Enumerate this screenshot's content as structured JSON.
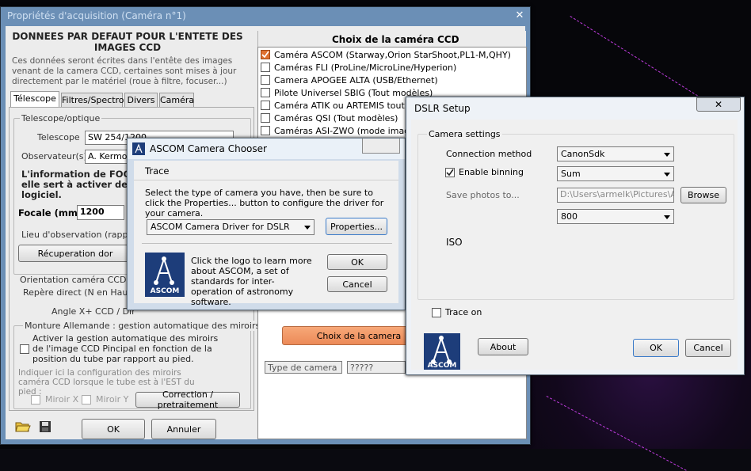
{
  "main": {
    "title": "Propriétés d'acquisition (Caméra n°1)",
    "heading": "DONNEES PAR DEFAUT POUR L'ENTETE DES IMAGES CCD",
    "intro": "Ces données seront écrites dans l'entête des images  venant de la camera CCD, certaines sont mises à jour directement par le matériel (roue à filtre, focuser...)",
    "tabs": [
      {
        "label": "Télescope"
      },
      {
        "label": "Filtres/Spectro"
      },
      {
        "label": "Divers"
      },
      {
        "label": "Caméra"
      }
    ],
    "telescope": {
      "group_label": "Telescope/optique",
      "telescope_label": "Telescope",
      "telescope_value": "SW 254/1200",
      "observer_label": "Observateur(s)",
      "observer_value": "A. Kermor",
      "focal_info_line1": "L'information de FOCAL",
      "focal_info_line2": "elle sert à activer des f",
      "focal_info_line3": "logiciel.",
      "focal_label": "Focale (mm)",
      "focal_value": "1200",
      "lieu_label": "Lieu d'observation (rappel)",
      "recup_button": "Récuperation dor"
    },
    "orientation": {
      "group_label": "Orientation caméra CCD",
      "repere": "Repère direct (N en Haut, E",
      "angle": "Angle X+ CCD / Dir"
    },
    "monture": {
      "group_label": "Monture Allemande : gestion automatique des miroirs",
      "checkbox_text": "Activer la gestion automatique des miroirs de l'image CCD Pincipal en fonction de la position du tube par rapport au pied.",
      "config_text": "Indiquer ici la configuration des miroirs caméra CCD lorsque le tube est à l'EST du pied :",
      "mirror_x": "Miroir X",
      "mirror_y": "Miroir Y",
      "correction_button": "Correction / pretraitement"
    },
    "ok_button": "OK",
    "cancel_button": "Annuler",
    "ccd": {
      "heading": "Choix de la caméra CCD",
      "items": [
        {
          "label": "Caméra ASCOM (Starway,Orion StarShoot,PL1-M,QHY)",
          "checked": true
        },
        {
          "label": "Caméras FLI (ProLine/MicroLine/Hyperion)",
          "checked": false
        },
        {
          "label": "Camera APOGEE ALTA (USB/Ethernet)",
          "checked": false
        },
        {
          "label": "Pilote Universel SBIG (Tout modèles)",
          "checked": false
        },
        {
          "label": "Caméra ATIK ou ARTEMIS tout mo",
          "checked": false
        },
        {
          "label": "Caméras QSI (Tout modèles)",
          "checked": false
        },
        {
          "label": "Caméras ASI-ZWO (mode image pa",
          "checked": false
        }
      ],
      "choose_button": "Choix de la camera",
      "type_label": "Type de camera",
      "type_value": "?????"
    }
  },
  "ascom": {
    "title": "ASCOM Camera Chooser",
    "menu_trace": "Trace",
    "instructions": "Select the type of camera you have, then be sure to click the Properties... button to configure the driver for your camera.",
    "driver_value": "ASCOM Camera Driver for DSLR",
    "properties_button": "Properties...",
    "logo_text": "Click the logo to learn more about ASCOM, a set of standards for inter-operation of astronomy software.",
    "logo_label": "ASCOM",
    "ok_button": "OK",
    "cancel_button": "Cancel"
  },
  "dslr": {
    "title": "DSLR Setup",
    "group_label": "Camera settings",
    "connection_label": "Connection method",
    "connection_value": "CanonSdk",
    "binning_label": "Enable binning",
    "binning_value": "Sum",
    "save_label": "Save photos to...",
    "save_value": "D:\\Users\\armelk\\Pictures\\ASI",
    "browse_button": "Browse",
    "iso_value": "800",
    "iso_label": "ISO",
    "trace_label": "Trace on",
    "logo_label": "ASCOM",
    "about_button": "About",
    "ok_button": "OK",
    "cancel_button": "Cancel"
  },
  "colors": {
    "title_blue": "#6b8fb6",
    "choose_button_orange": "#f09060",
    "checkbox_checked": "#e07030",
    "ascom_logo_blue": "#1d3d7a"
  },
  "icons": [
    "open-folder-icon",
    "save-disk-icon",
    "close-icon",
    "ascom-logo-icon",
    "chevron-down-icon"
  ]
}
